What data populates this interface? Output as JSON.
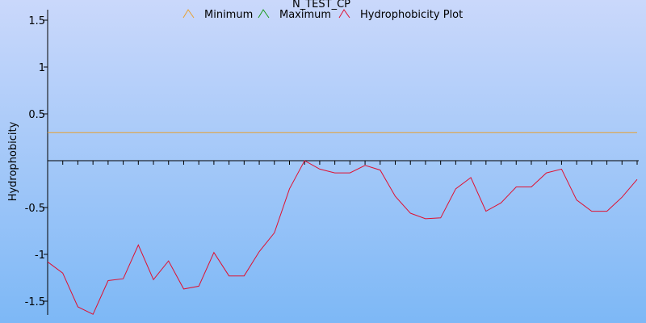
{
  "chart_data": {
    "type": "line",
    "title": "N_TEST_CP",
    "xlabel": "",
    "ylabel": "Hydrophobicity",
    "ylim": [
      -1.65,
      1.65
    ],
    "y_ticks": [
      -1.5,
      -1,
      -0.5,
      0.5,
      1,
      1.5
    ],
    "y_tick_labels": [
      "-1.5",
      "-1",
      "-0.5",
      "0.5",
      "1",
      "1.5"
    ],
    "x_tick_count": 39,
    "grid": false,
    "legend": "top-center",
    "colors": {
      "minimum": "#e8a030",
      "maximum": "#1a9a1a",
      "hydrophobicity": "#e01030",
      "axis": "#000000",
      "bg_top": "#cad8fb",
      "bg_bottom": "#7db8f6"
    },
    "series": [
      {
        "name": "Minimum",
        "key": "minimum",
        "values": [
          0.3,
          0.3
        ]
      },
      {
        "name": "Maximum",
        "key": "maximum",
        "values": []
      },
      {
        "name": "Hydrophobicity Plot",
        "key": "hydrophobicity",
        "values": [
          -1.08,
          -1.2,
          -1.56,
          -1.64,
          -1.28,
          -1.26,
          -0.9,
          -1.27,
          -1.07,
          -1.37,
          -1.34,
          -0.98,
          -1.23,
          -1.23,
          -0.97,
          -0.77,
          -0.3,
          0.0,
          -0.09,
          -0.13,
          -0.13,
          -0.05,
          -0.1,
          -0.38,
          -0.56,
          -0.62,
          -0.61,
          -0.3,
          -0.18,
          -0.54,
          -0.45,
          -0.28,
          -0.28,
          -0.13,
          -0.09,
          -0.42,
          -0.54,
          -0.54,
          -0.39,
          -0.2
        ]
      }
    ]
  }
}
